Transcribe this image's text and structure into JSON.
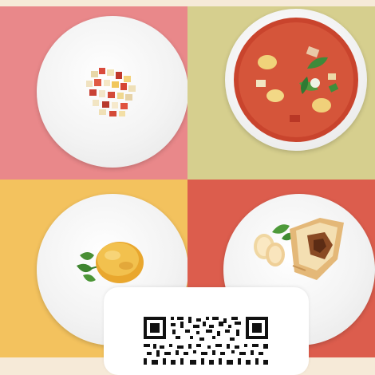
{
  "colors": {
    "top_strip": "#f6ead8",
    "panel_top_left": "#e9888a",
    "panel_top_right": "#d6cf8e",
    "panel_bottom_left": "#f3c25e",
    "panel_bottom_right": "#dc5d4d",
    "plate": "#f4f4f4",
    "qr_card": "#ffffff"
  },
  "dishes": [
    {
      "name": "diced-vegetable-salad"
    },
    {
      "name": "tomato-vegetable-soup"
    },
    {
      "name": "cheese-cutlet-with-parsley"
    },
    {
      "name": "puff-pastry-with-apple"
    }
  ],
  "qr": {
    "icon": "qr-code-icon"
  }
}
